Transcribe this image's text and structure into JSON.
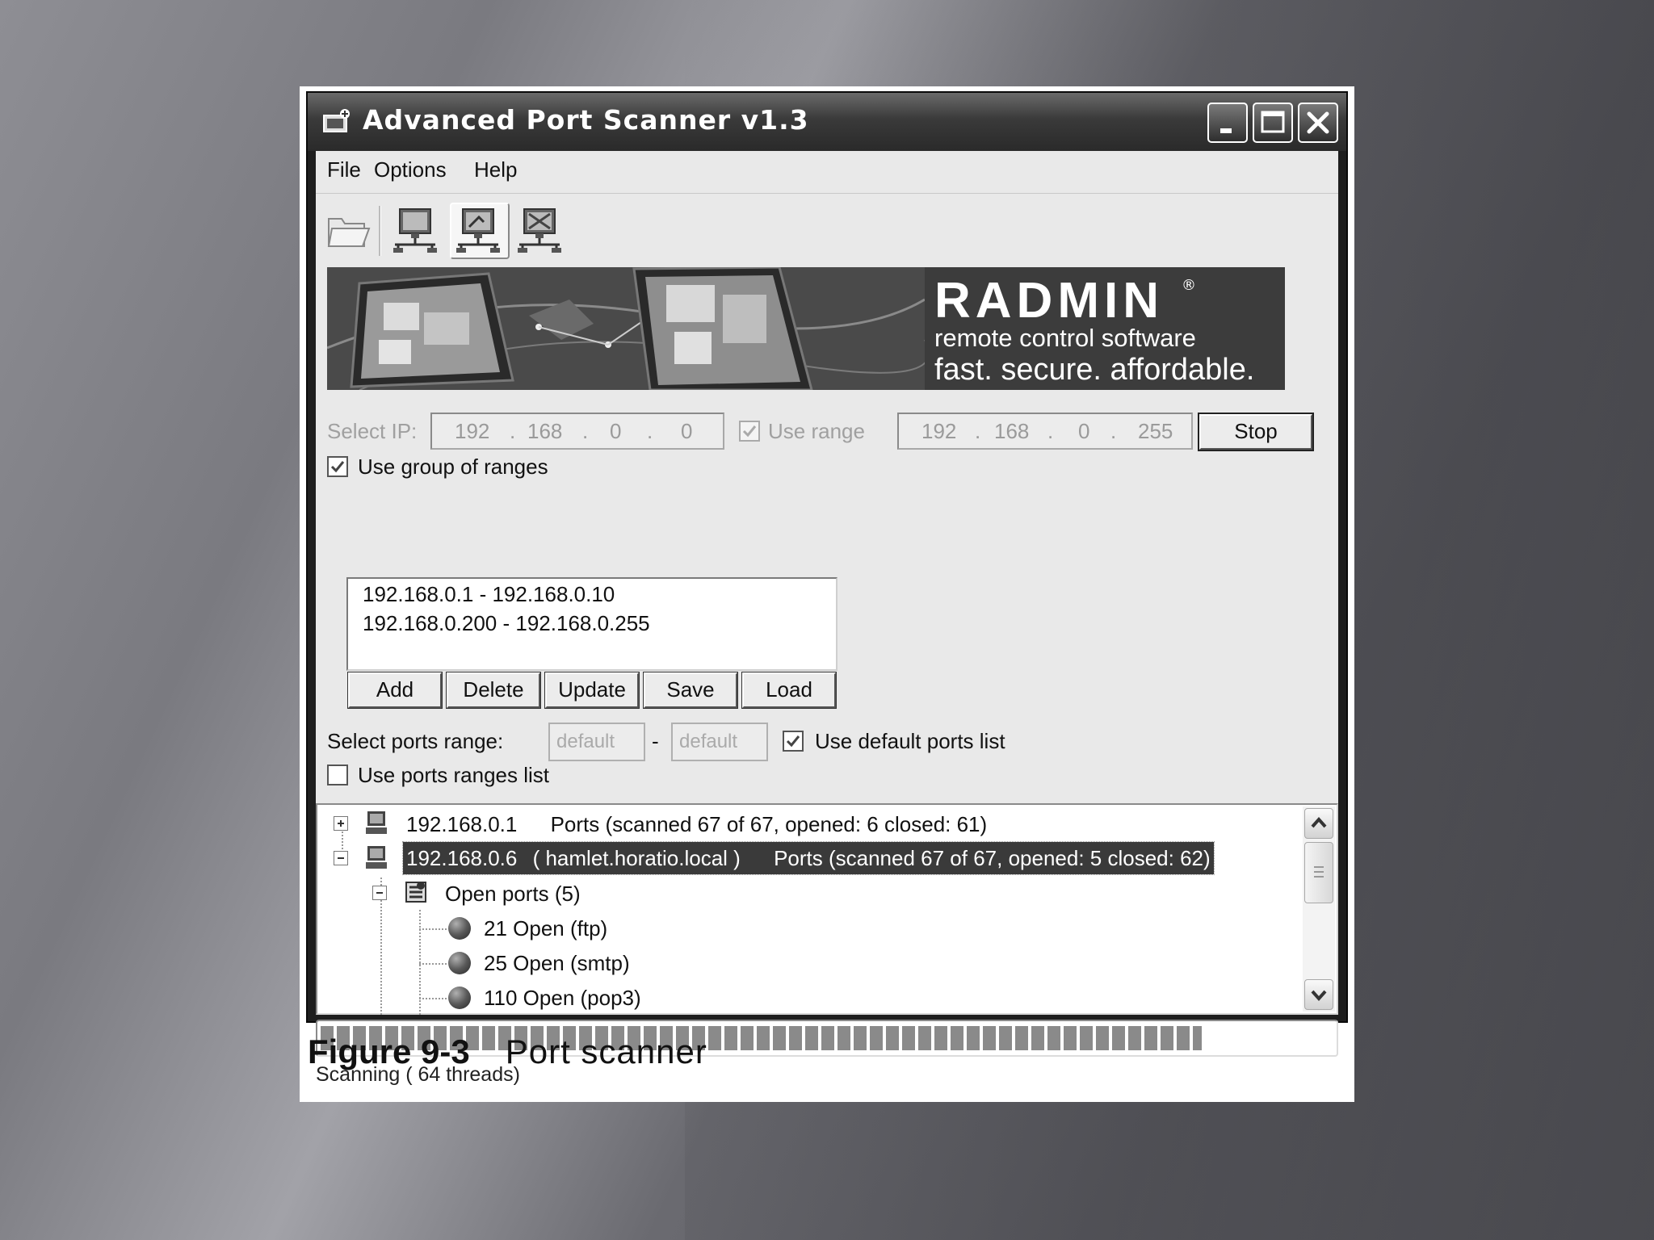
{
  "window": {
    "title": "Advanced Port Scanner v1.3",
    "controls": [
      "minimize-icon",
      "maximize-icon",
      "close-icon"
    ]
  },
  "menu": [
    "File",
    "Options",
    "Help"
  ],
  "toolbar": {
    "icons": [
      "open-folder-icon",
      "scan-network-icon",
      "scan-ports-icon",
      "stop-scan-icon"
    ],
    "active_index": 2
  },
  "banner": {
    "title": "RADMIN",
    "registered": "®",
    "subtitle": "remote control software",
    "tagline": "fast. secure. affordable."
  },
  "ip_select": {
    "label": "Select IP:",
    "from": [
      "192",
      "168",
      "0",
      "0"
    ],
    "use_range_label": "Use range",
    "use_range_checked": true,
    "to": [
      "192",
      "168",
      "0",
      "255"
    ],
    "dot": ".",
    "stop_label": "Stop"
  },
  "group": {
    "label": "Use group of ranges",
    "checked": true,
    "ranges": [
      "192.168.0.1 - 192.168.0.10",
      "192.168.0.200 - 192.168.0.255"
    ],
    "buttons": [
      "Add",
      "Delete",
      "Update",
      "Save",
      "Load"
    ]
  },
  "ports": {
    "label": "Select ports range:",
    "from_placeholder": "default",
    "separator": "-",
    "to_placeholder": "default",
    "use_default_label": "Use default ports list",
    "use_default_checked": true,
    "use_ranges_list_label": "Use ports ranges list",
    "use_ranges_list_checked": false
  },
  "results": {
    "hosts": [
      {
        "ip": "192.168.0.1",
        "hostname": "",
        "ports": "Ports (scanned 67 of 67, opened: 6 closed: 61)",
        "expanded": false
      },
      {
        "ip": "192.168.0.6",
        "hostname": "( hamlet.horatio.local )",
        "ports": "Ports (scanned 67 of 67, opened: 5 closed: 62)",
        "expanded": true
      }
    ],
    "group_label": "Open ports (5)",
    "open_ports": [
      "21 Open (ftp)",
      "25 Open (smtp)",
      "110 Open (pop3)"
    ]
  },
  "progress": {
    "value": 0.87
  },
  "status": "Scanning ( 64 threads)",
  "caption": {
    "number": "Figure 9-3",
    "text": "Port scanner"
  },
  "colors": {
    "selected_row": "#3a3a3a",
    "banner_bg": "#3c3c3c",
    "title_bar": "#2a2a2a"
  }
}
